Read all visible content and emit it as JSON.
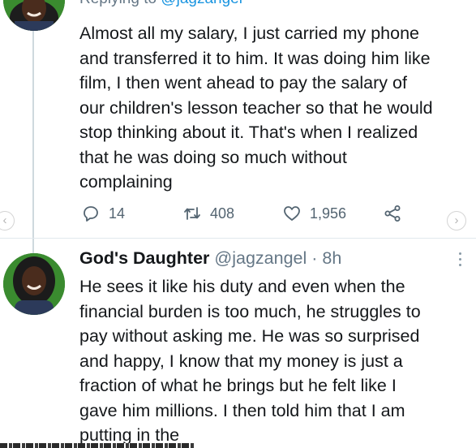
{
  "reply_context": {
    "prefix": "Replying to ",
    "mention": "@jagzangel"
  },
  "first_tweet": {
    "lines": [
      "Almost all my salary,  I just carried my phone",
      "and transferred it to him. It was doing him like",
      "film, I then went ahead to pay the salary of",
      "our children's lesson teacher so that he would",
      "stop thinking about it. That's when I realized",
      "that he was doing so much without",
      "complaining"
    ],
    "actions": {
      "reply_count": "14",
      "retweet_count": "408",
      "like_count": "1,956"
    }
  },
  "second_tweet": {
    "author_name": "God's Daughter",
    "handle": "@jagzangel",
    "separator": "·",
    "time": "8h",
    "lines": [
      "He sees it like his duty and even when the",
      "financial burden is too much, he struggles to",
      "pay without asking me. He was so surprised",
      "and happy, I know that my money is just a",
      "fraction of what he brings but he felt like I",
      "gave him millions. I then told him that I am",
      "putting in the"
    ]
  },
  "carousel": {
    "prev_glyph": "‹",
    "next_glyph": "›"
  },
  "colors": {
    "link": "#1b95e0",
    "muted": "#657786",
    "icon": "#536471",
    "text": "#14171a",
    "thread_line": "#cfd9de"
  },
  "icons": {
    "reply": "speech-bubble-icon",
    "retweet": "retweet-icon",
    "like": "heart-icon",
    "share": "share-icon",
    "more": "more-vertical-icon"
  }
}
